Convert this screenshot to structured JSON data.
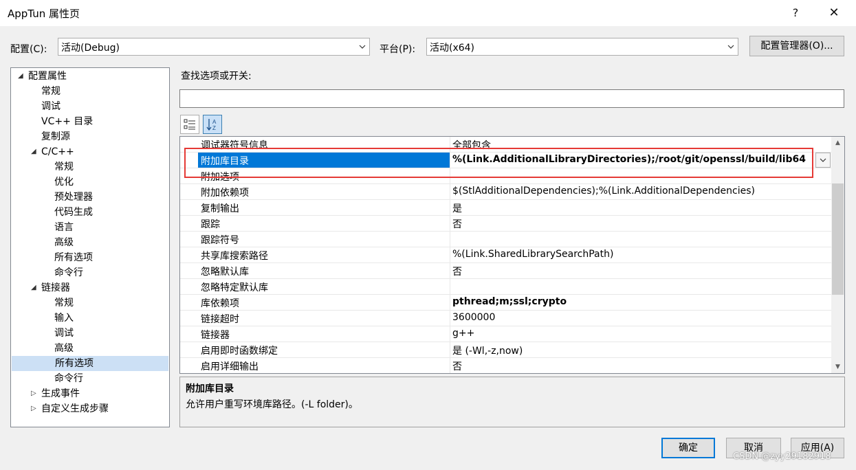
{
  "window": {
    "title": "AppTun 属性页",
    "help": "?",
    "close": "✕"
  },
  "config": {
    "label": "配置(C):",
    "value": "活动(Debug)"
  },
  "platform": {
    "label": "平台(P):",
    "value": "活动(x64)"
  },
  "config_manager_label": "配置管理器(O)...",
  "tree": {
    "items": [
      {
        "label": "配置属性",
        "level": 0,
        "expander": "expanded"
      },
      {
        "label": "常规",
        "level": 1
      },
      {
        "label": "调试",
        "level": 1
      },
      {
        "label": "VC++ 目录",
        "level": 1
      },
      {
        "label": "复制源",
        "level": 1
      },
      {
        "label": "C/C++",
        "level": 1,
        "expander": "expanded"
      },
      {
        "label": "常规",
        "level": 2
      },
      {
        "label": "优化",
        "level": 2
      },
      {
        "label": "预处理器",
        "level": 2
      },
      {
        "label": "代码生成",
        "level": 2
      },
      {
        "label": "语言",
        "level": 2
      },
      {
        "label": "高级",
        "level": 2
      },
      {
        "label": "所有选项",
        "level": 2
      },
      {
        "label": "命令行",
        "level": 2
      },
      {
        "label": "链接器",
        "level": 1,
        "expander": "expanded"
      },
      {
        "label": "常规",
        "level": 2
      },
      {
        "label": "输入",
        "level": 2
      },
      {
        "label": "调试",
        "level": 2
      },
      {
        "label": "高级",
        "level": 2
      },
      {
        "label": "所有选项",
        "level": 2,
        "selected": true
      },
      {
        "label": "命令行",
        "level": 2
      },
      {
        "label": "生成事件",
        "level": 1,
        "expander": "collapsed"
      },
      {
        "label": "自定义生成步骤",
        "level": 1,
        "expander": "collapsed"
      }
    ]
  },
  "search": {
    "label": "查找选项或开关:",
    "value": ""
  },
  "grid": {
    "rows": [
      {
        "name": "调试器符号信息",
        "value": "全部包含",
        "bold": false
      },
      {
        "name": "附加库目录",
        "value": "%(Link.AdditionalLibraryDirectories);/root/git/openssl/build/lib64",
        "bold": true,
        "selected": true
      },
      {
        "name": "附加选项",
        "value": "",
        "bold": false
      },
      {
        "name": "附加依赖项",
        "value": "$(StlAdditionalDependencies);%(Link.AdditionalDependencies)",
        "bold": false
      },
      {
        "name": "复制输出",
        "value": "是",
        "bold": false
      },
      {
        "name": "跟踪",
        "value": "否",
        "bold": false
      },
      {
        "name": "跟踪符号",
        "value": "",
        "bold": false
      },
      {
        "name": "共享库搜索路径",
        "value": "%(Link.SharedLibrarySearchPath)",
        "bold": false
      },
      {
        "name": "忽略默认库",
        "value": "否",
        "bold": false
      },
      {
        "name": "忽略特定默认库",
        "value": "",
        "bold": false
      },
      {
        "name": "库依赖项",
        "value": "pthread;m;ssl;crypto",
        "bold": true
      },
      {
        "name": "链接超时",
        "value": "3600000",
        "bold": false
      },
      {
        "name": "链接器",
        "value": "g++",
        "bold": false
      },
      {
        "name": "启用即时函数绑定",
        "value": "是 (-Wl,-z,now)",
        "bold": false
      },
      {
        "name": "启用详细输出",
        "value": "否",
        "bold": false
      }
    ]
  },
  "description": {
    "title": "附加库目录",
    "text": "允许用户重写环境库路径。(-L folder)。"
  },
  "buttons": {
    "ok": "确定",
    "cancel": "取消",
    "apply": "应用(A)"
  },
  "watermark": "CSDN @zyy29182918",
  "colors": {
    "selection": "#0078d7",
    "highlight_box": "#e53935",
    "tree_selection": "#cce0f5"
  }
}
